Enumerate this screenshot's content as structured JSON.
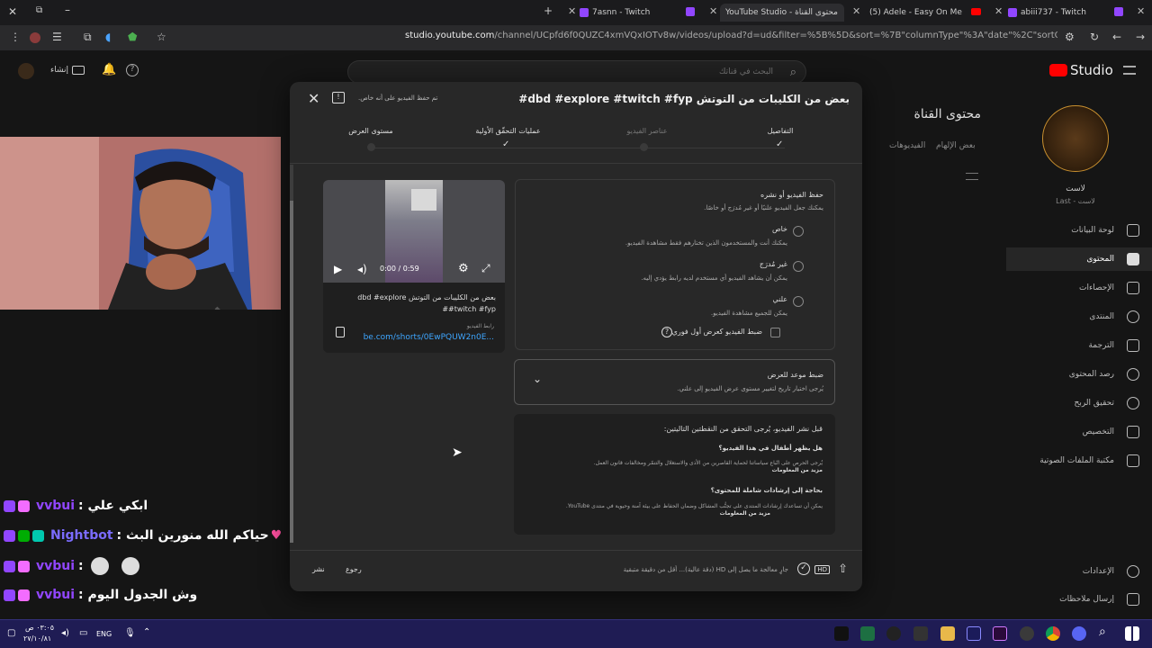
{
  "browser": {
    "tabs": [
      {
        "title": "7asnn - Twitch",
        "icon_color": "#9146ff"
      },
      {
        "title": "YouTube Studio - محتوى القناة",
        "icon_color": "#ff0000",
        "active": true
      },
      {
        "title": "(5) Adele - Easy On Me (Off",
        "icon_color": "#ff0000"
      },
      {
        "title": "abiii737 - Twitch",
        "icon_color": "#9146ff"
      }
    ],
    "url_host": "studio.youtube.com",
    "url_path": "/channel/UCpfd6f0QUZC4xmVQxIOTv8w/videos/upload?d=ud&filter=%5B%5D&sort=%7B\"columnType\"%3A\"date\"%2C\"sortOrder\"%3A\"DESCENDING\"%7D"
  },
  "studio": {
    "logo": "Studio",
    "search_placeholder": "البحث في قناتك",
    "create_label": "إنشاء",
    "page_title": "محتوى القناة",
    "tabs": [
      "بعض الإلهام",
      "الفيديوهات"
    ],
    "channel_name": "لاست",
    "channel_handle": "Last - لاست",
    "nav": [
      "لوحة البيانات",
      "المحتوى",
      "الإحصاءات",
      "المنتدى",
      "الترجمة",
      "رصد المحتوى",
      "تحقيق الربح",
      "التخصيص",
      "مكتبة الملفات الصوتية",
      "الإعدادات",
      "إرسال ملاحظات"
    ]
  },
  "dialog": {
    "title": "بعض من الكليبات من التوتش dbd #explore #twitch #fyp#",
    "saved_status": "تم حفظ الفيديو على أنه خاص.",
    "steps": [
      {
        "label": "التفاصيل",
        "done": true
      },
      {
        "label": "عناصر الفيديو",
        "done": false
      },
      {
        "label": "عمليات التحقّق الأولية",
        "done": true
      },
      {
        "label": "مستوى العرض",
        "done": false
      }
    ],
    "visibility": {
      "heading": "حفظ الفيديو أو نشره",
      "subheading": "يمكنك جعل الفيديو علنيًا أو غير مُدرَج أو خاصًا.",
      "options": [
        {
          "label": "خاص",
          "desc": "يمكنك أنت والمستخدمون الذين تختارهم فقط مشاهدة الفيديو."
        },
        {
          "label": "غير مُدرَج",
          "desc": "يمكن أن يشاهد الفيديو أي مستخدم لديه رابط يؤدي إليه."
        },
        {
          "label": "علني",
          "desc": "يمكن للجميع مشاهدة الفيديو."
        }
      ],
      "premiere_label": "ضبط الفيديو كعرض أول فوري"
    },
    "schedule": {
      "title": "ضبط موعد للعرض",
      "desc": "يُرجى اختيار تاريخ لتغيير مستوى عرض الفيديو إلى علني."
    },
    "check": {
      "title": "قبل نشر الفيديو، يُرجى التحقق من النقطتين التاليتين:",
      "q1_title": "هل يظهر أطفال في هذا الفيديو؟",
      "q1_desc": "يُرجى الحرص على اتّباع سياساتنا لحماية القاصرين من الأذى والاستغلال والتنمّر ومخالفات قانون العمل.",
      "q1_more": "مزيد من المعلومات",
      "q2_title": "بحاجة إلى إرشادات شاملة للمحتوى؟",
      "q2_desc": "يمكن أن تساعدك إرشادات المنتدى على تجنُّب المشاكل وضمان الحفاظ على بيئة آمنة وحيوية في منتدى YouTube.",
      "q2_more": "مزيد من المعلومات"
    },
    "preview": {
      "time": "0:00 / 0:59",
      "title": "بعض من الكليبات من التوتش dbd #explore #twitch #fyp#",
      "link_label": "رابط الفيديو",
      "link": "be.com/shorts/0EwPQUW2n0E..."
    },
    "footer": {
      "status": "جارٍ معالجة ما يصل إلى HD (دقة عالية)... أقل من دقيقة متبقية",
      "hd": "HD",
      "back": "رجوع",
      "publish": "نشر"
    }
  },
  "chat": [
    {
      "user": "vvbui",
      "msg": "ابكي علي :",
      "user_color": "#9146ff"
    },
    {
      "user": "Nightbot",
      "msg": "حياكم الله منورين البث :",
      "user_color": "#7b6cff"
    },
    {
      "user": "vvbui",
      "msg": ":",
      "user_color": "#9146ff"
    },
    {
      "user": "vvbui",
      "msg": "وش الجدول اليوم :",
      "user_color": "#9146ff"
    }
  ],
  "taskbar": {
    "lang": "ENG",
    "time": "٠٣:٠٥ ص",
    "date": "٢٧/١٠/٨١"
  }
}
